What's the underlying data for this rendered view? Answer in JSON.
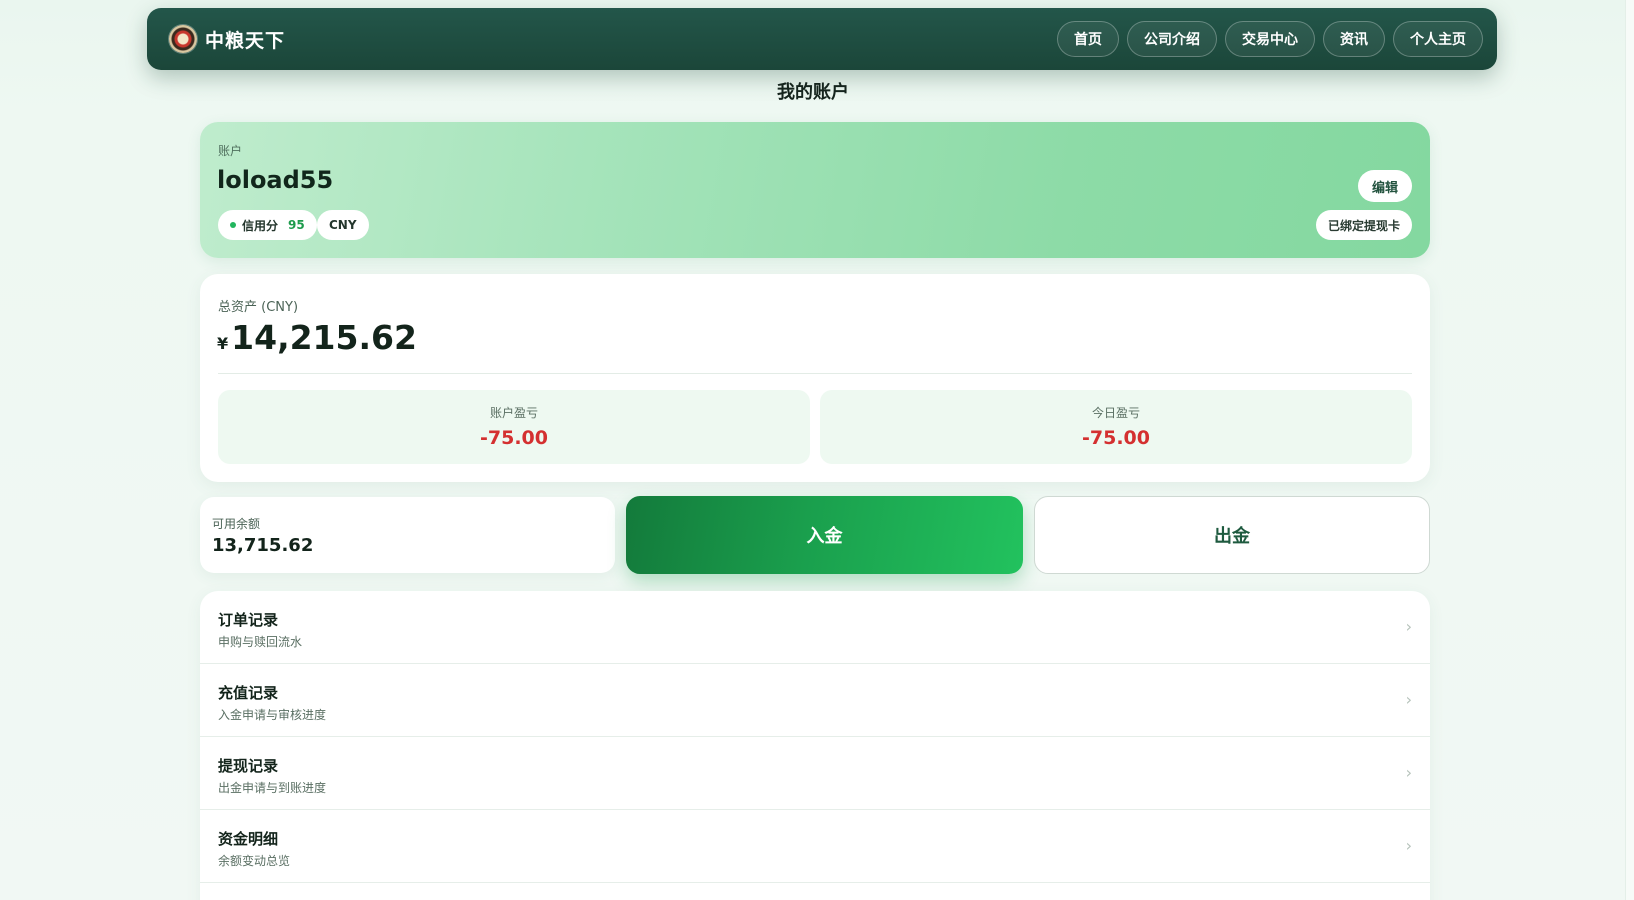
{
  "brand": {
    "name": "中粮天下",
    "logo_icon": "company-seal-logo"
  },
  "nav": {
    "items": [
      {
        "label": "首页"
      },
      {
        "label": "公司介绍"
      },
      {
        "label": "交易中心"
      },
      {
        "label": "资讯"
      },
      {
        "label": "个人主页"
      }
    ]
  },
  "page": {
    "title": "我的账户"
  },
  "account": {
    "label": "账户",
    "username": "loload55",
    "credit_label": "信用分",
    "credit_score": "95",
    "currency": "CNY",
    "edit_label": "编辑",
    "card_status": "已绑定提现卡"
  },
  "assets": {
    "label": "总资产 (CNY)",
    "currency_symbol": "¥",
    "total": "14,215.62",
    "account_pnl_label": "账户盈亏",
    "account_pnl": "-75.00",
    "today_pnl_label": "今日盈亏",
    "today_pnl": "-75.00"
  },
  "balance": {
    "label": "可用余额",
    "value": "13,715.62"
  },
  "actions": {
    "deposit_label": "入金",
    "withdraw_label": "出金"
  },
  "menu": {
    "items": [
      {
        "title": "订单记录",
        "subtitle": "申购与赎回流水"
      },
      {
        "title": "充值记录",
        "subtitle": "入金申请与审核进度"
      },
      {
        "title": "提现记录",
        "subtitle": "出金申请与到账进度"
      },
      {
        "title": "资金明细",
        "subtitle": "余额变动总览"
      }
    ]
  },
  "colors": {
    "nav_bg": "#1f4f42",
    "accent_green": "#1a9f4d",
    "loss_red": "#d43030",
    "account_card": "#a3e3b9"
  }
}
